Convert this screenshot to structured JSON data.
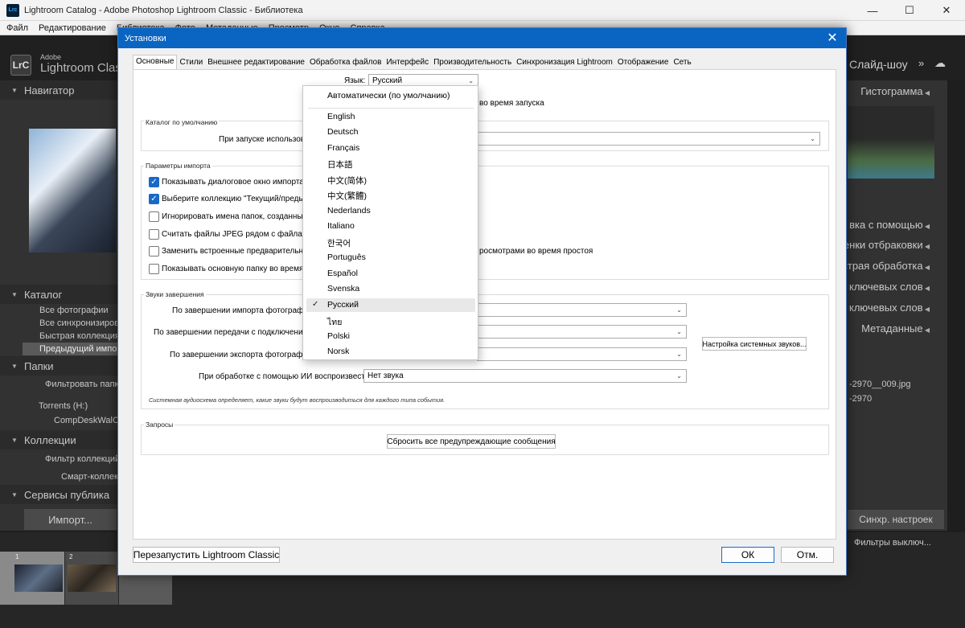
{
  "window": {
    "title": "Lightroom Catalog - Adobe Photoshop Lightroom Classic - Библиотека",
    "app_icon": "Lrc",
    "minimize": "—",
    "maximize": "☐",
    "close": "✕"
  },
  "menubar": [
    "Файл",
    "Редактирование",
    "Библиотека",
    "Фото",
    "Метаданные",
    "Просмотр",
    "Окно",
    "Справка"
  ],
  "lightroom": {
    "logo_text": "LrC",
    "brand_small": "Adobe",
    "brand_large": "Lightroom Class",
    "module_right": "Слайд-шоу",
    "left_panel": {
      "navigator": "Навигатор",
      "catalog": "Каталог",
      "catalog_items": [
        "Все фотографии",
        "Все синхронизирован",
        "Быстрая коллекция  +",
        "Предыдущий импорт"
      ],
      "folders": "Папки",
      "folders_filter": "Фильтровать папки",
      "drive": "Torrents (H:)",
      "folder": "CompDeskWalCol-2",
      "collections": "Коллекции",
      "collections_filter": "Фильтр коллекций",
      "smart": "Смарт-коллекци",
      "publish": "Сервисы публика",
      "import_button": "Импорт..."
    },
    "right_panel": {
      "histogram": "Гистограмма",
      "items": [
        "вка с помощью",
        "ненки отбраковки",
        "страя обработка",
        "е ключевых слов",
        "к ключевых слов"
      ],
      "metadata": "Метаданные",
      "file1": "-2970__009.jpg",
      "file2": "-2970",
      "sync_button": "Синхр. настроек",
      "filter": "Фильтры выключ..."
    },
    "filmstrip": {
      "n1": "1",
      "n2": "2"
    }
  },
  "dialog": {
    "title": "Установки",
    "close": "✕",
    "tabs": [
      "Основные",
      "Стили",
      "Внешнее редактирование",
      "Обработка файлов",
      "Интерфейс",
      "Производительность",
      "Синхронизация Lightroom",
      "Отображение",
      "Сеть"
    ],
    "language_label": "Язык:",
    "language_value": "Русский",
    "startup_tail": "во время запуска",
    "catalog_group": "Каталог по умолчанию",
    "catalog_label": "При запуске использова",
    "import_group": "Параметры импорта",
    "import_options": [
      {
        "label": "Показывать диалоговое окно импорта пр",
        "checked": true
      },
      {
        "label": "Выберите коллекцию \"Текущий/предыду",
        "checked": true
      },
      {
        "label": "Игнорировать имена папок, созданные к",
        "checked": false
      },
      {
        "label": "Считать файлы JPEG рядом с файлами R",
        "checked": false
      },
      {
        "label": "Заменить встроенные предварительные",
        "checked": false
      },
      {
        "label": "Показывать основную папку во время им",
        "checked": false
      }
    ],
    "replace_tail": "росмотрами во время простоя",
    "sounds_group": "Звуки завершения",
    "sound_rows": [
      {
        "label": "По завершении импорта фотографий",
        "value": ""
      },
      {
        "label": "По завершении передачи с подключением",
        "value": ""
      },
      {
        "label": "По завершении экспорта фотографий",
        "value": ""
      },
      {
        "label": "При обработке с помощью ИИ воспроизвести:",
        "value": "Нет звука"
      }
    ],
    "system_sounds_button": "Настройка системных звуков...",
    "sounds_note": "Системная аудиосхема определяет, какие звуки будут воспроизводиться для каждого типа события.",
    "prompts_group": "Запросы",
    "reset_button": "Сбросить все предупреждающие сообщения",
    "restart_button": "Перезапустить Lightroom Classic",
    "ok_button": "ОК",
    "cancel_button": "Отм."
  },
  "language_dropdown": {
    "auto": "Автоматически (по умолчанию)",
    "options": [
      "English",
      "Deutsch",
      "Français",
      "日本語",
      "中文(简体)",
      "中文(繁體)",
      "Nederlands",
      "Italiano",
      "한국어",
      "Português",
      "Español",
      "Svenska",
      "Русский",
      "ไทย",
      "Polski",
      "Norsk"
    ],
    "selected": "Русский",
    "check": "✓"
  }
}
